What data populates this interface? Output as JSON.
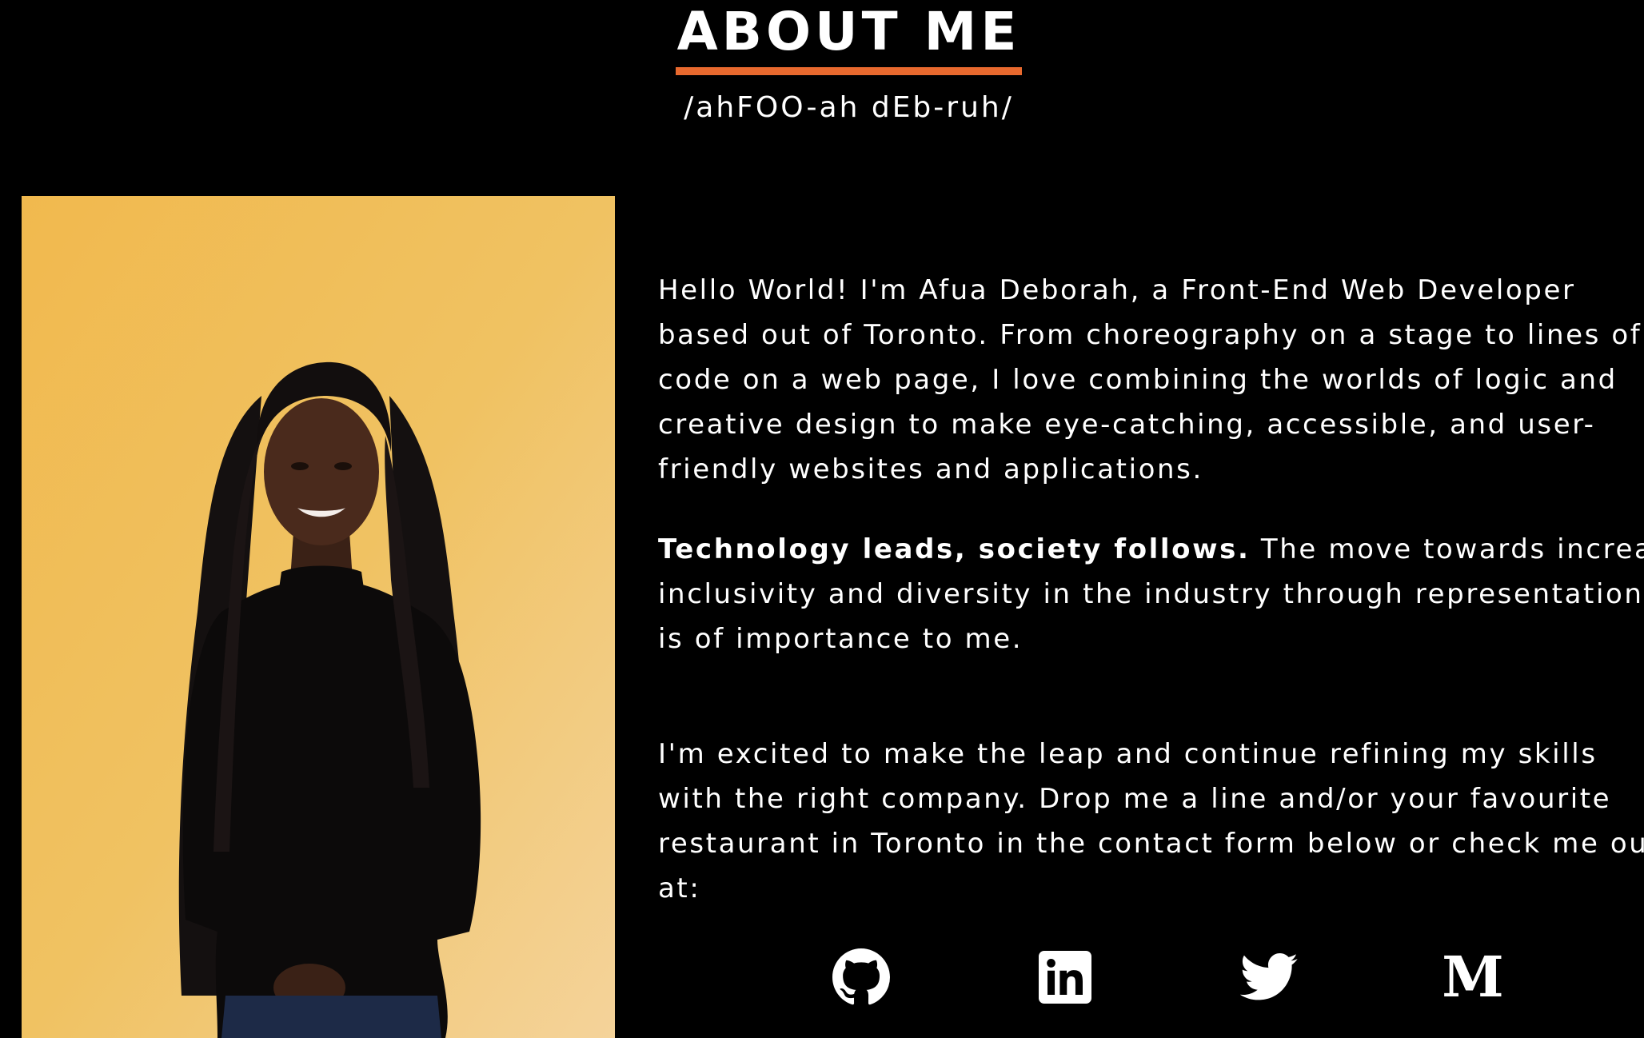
{
  "section": {
    "title": "ABOUT ME",
    "pronunciation": "/ahFOO-ah dEb-ruh/",
    "accent_color": "#e8692e",
    "background_color": "#000000"
  },
  "photo": {
    "background_color": "#eebc55"
  },
  "bio": {
    "p1_lines": [
      "Hello World! I'm Afua Deborah, a Front-End Web Developer",
      "based out of Toronto. From choreography on a stage to lines of",
      "code on a web page, I love combining the worlds of logic and",
      "creative design to make eye-catching, accessible, and user-",
      "friendly websites and applications."
    ],
    "p2_bold": "Technology leads, society follows.",
    "p2_rest_line1": " The move towards increasing",
    "p2_lines": [
      "inclusivity and diversity in the industry through representation",
      "is of importance to me."
    ],
    "p3_lines": [
      "I'm excited to make the leap and continue refining my skills",
      "with the right company. Drop me a line and/or your favourite",
      "restaurant in Toronto in the contact form below or check me out",
      "at:"
    ]
  },
  "socials": [
    {
      "icon": "github-icon"
    },
    {
      "icon": "linkedin-icon"
    },
    {
      "icon": "twitter-icon"
    },
    {
      "icon": "medium-icon",
      "glyph": "M"
    }
  ]
}
